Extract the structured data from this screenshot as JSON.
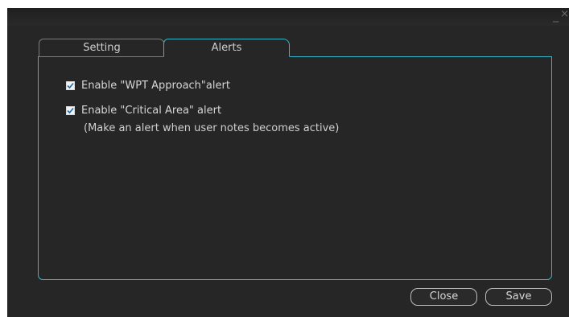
{
  "window": {
    "minimize_glyph": "_",
    "close_glyph": "×"
  },
  "tabs": [
    {
      "label": "Setting",
      "active": false
    },
    {
      "label": "Alerts",
      "active": true
    }
  ],
  "alerts": {
    "options": [
      {
        "label": "Enable \"WPT Approach\"alert",
        "checked": true
      },
      {
        "label": "Enable \"Critical Area\" alert",
        "checked": true
      }
    ],
    "note": "(Make an alert when user notes becomes active)"
  },
  "buttons": {
    "close_label": "Close",
    "save_label": "Save"
  },
  "colors": {
    "background": "#262626",
    "accent": "#34b6c8",
    "text": "#d6d6d6",
    "border": "#7d7d7d"
  }
}
